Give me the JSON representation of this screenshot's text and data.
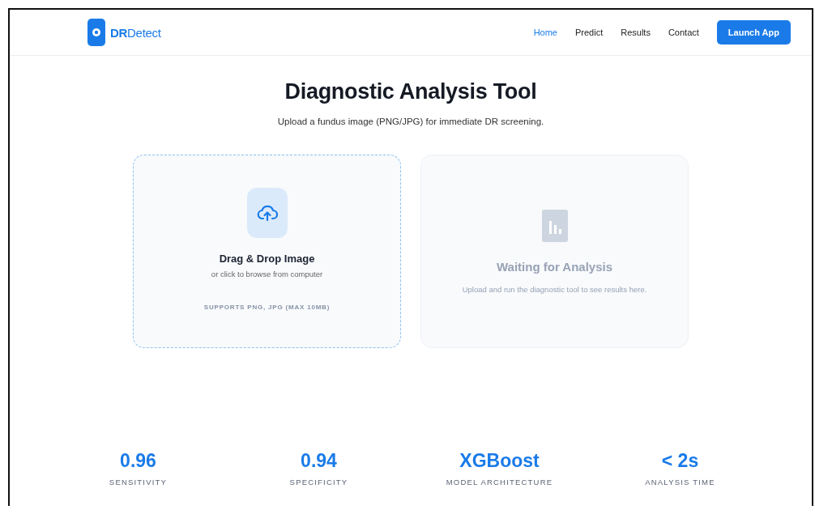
{
  "brand": {
    "name": "**DR**Detect"
  },
  "nav": [
    {
      "label": "Home",
      "selected": true
    },
    {
      "label": "Predict",
      "selected": false
    },
    {
      "label": "Results",
      "selected": false
    },
    {
      "label": "Contact",
      "selected": false
    }
  ],
  "cta": "Launch App",
  "hero": {
    "title": "Diagnostic Analysis Tool",
    "subtitle": "Upload a fundus image (PNG/JPG) for immediate DR screening."
  },
  "upload": {
    "title": "Drag & Drop Image",
    "hint": "or click to browse from computer",
    "note": "SUPPORTS PNG, JPG (MAX 10MB)"
  },
  "result": {
    "title": "Waiting for Analysis",
    "text": "Upload and run the diagnostic tool to see results here."
  },
  "stats": [
    {
      "value": "0.96",
      "label": "SENSITIVITY"
    },
    {
      "value": "0.94",
      "label": "SPECIFICITY"
    },
    {
      "value": "XGBoost",
      "label": "MODEL ARCHITECTURE"
    },
    {
      "value": "< 2s",
      "label": "ANALYSIS TIME"
    }
  ]
}
